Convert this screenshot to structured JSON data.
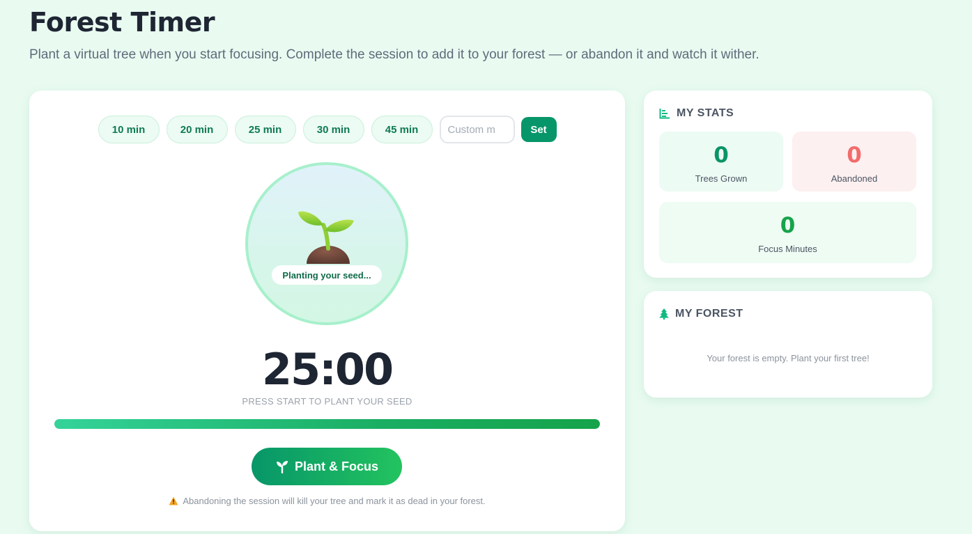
{
  "header": {
    "title": "Forest Timer",
    "subtitle": "Plant a virtual tree when you start focusing. Complete the session to add it to your forest — or abandon it and watch it wither."
  },
  "presets": {
    "options": [
      "10 min",
      "20 min",
      "25 min",
      "30 min",
      "45 min"
    ],
    "custom_placeholder": "Custom m",
    "set_label": "Set"
  },
  "tree": {
    "icon": "sprout-icon",
    "status": "Planting your seed..."
  },
  "timer": {
    "display": "25:00",
    "hint": "PRESS START TO PLANT YOUR SEED",
    "progress_percent": 100
  },
  "actions": {
    "plant_label": "Plant & Focus",
    "warning": "Abandoning the session will kill your tree and mark it as dead in your forest."
  },
  "stats": {
    "title": "MY STATS",
    "trees_grown": {
      "value": "0",
      "label": "Trees Grown"
    },
    "abandoned": {
      "value": "0",
      "label": "Abandoned"
    },
    "focus_minutes": {
      "value": "0",
      "label": "Focus Minutes"
    }
  },
  "forest": {
    "title": "MY FOREST",
    "empty_message": "Your forest is empty. Plant your first tree!"
  },
  "colors": {
    "accent": "#079669",
    "abandoned": "#f26c6c",
    "background": "#e9fbf1"
  }
}
